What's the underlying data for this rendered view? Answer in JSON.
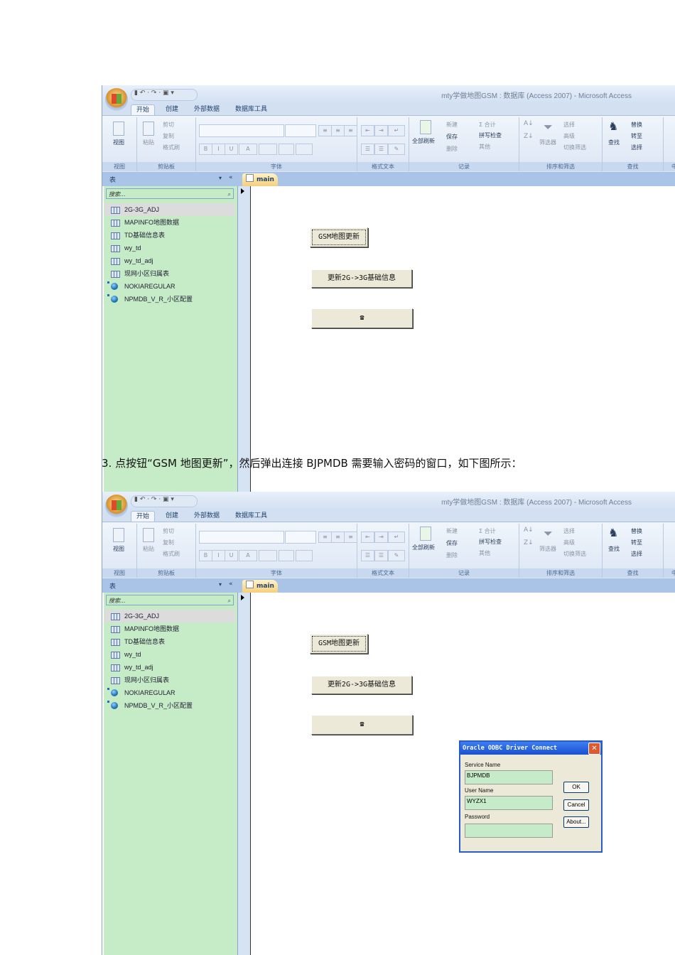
{
  "app": {
    "title": "mty学做地图GSM : 数据库 (Access 2007) - Microsoft Access",
    "qat": "▮ ↶ · ↷ · ▣ ▾",
    "tabs": [
      "开始",
      "创建",
      "外部数据",
      "数据库工具"
    ],
    "groups": {
      "view": {
        "label": "视图",
        "button": "视图"
      },
      "clipboard": {
        "label": "剪贴板",
        "paste": "粘贴",
        "cut": "剪切",
        "copy": "复制",
        "format_painter": "格式刷"
      },
      "font": {
        "label": "字体",
        "bold": "B",
        "italic": "I",
        "underline": "U",
        "color": "A"
      },
      "rich_text": {
        "label": "格式文本"
      },
      "records": {
        "label": "记录",
        "refresh_all": "全部刷新",
        "new": "新建",
        "save": "保存",
        "delete": "删除",
        "totals": "Σ 合计",
        "spelling": "拼写检查",
        "more": "其他"
      },
      "sort_filter": {
        "label": "排序和筛选",
        "filter": "筛选器",
        "selection": "选择",
        "advanced": "高级",
        "toggle_filter": "切换筛选"
      },
      "find": {
        "label": "查找",
        "find": "查找",
        "replace": "替换",
        "goto": "转至",
        "select": "选择"
      },
      "chinese": {
        "label": "中"
      }
    },
    "nav": {
      "header": "表",
      "search_placeholder": "搜索...",
      "items": [
        {
          "label": "2G-3G_ADJ",
          "type": "table"
        },
        {
          "label": "MAPINFO地图数据",
          "type": "table"
        },
        {
          "label": "TD基础信息表",
          "type": "table"
        },
        {
          "label": "wy_td",
          "type": "table"
        },
        {
          "label": "wy_td_adj",
          "type": "table"
        },
        {
          "label": "现网小区归属表",
          "type": "table"
        },
        {
          "label": "NOKIAREGULAR",
          "type": "linked"
        },
        {
          "label": "NPMDB_V_R_小区配置",
          "type": "linked"
        }
      ]
    },
    "doc_tab": "main",
    "form": {
      "btn_gsm": "GSM地图更新",
      "btn_update": "更新2G->3G基础信息",
      "btn_third": "☎"
    }
  },
  "paragraph": "3.  点按钮“GSM 地图更新”，然后弹出连接 BJPMDB 需要输入密码的窗口，如下图所示：",
  "dialog": {
    "title": "Oracle ODBC Driver Connect",
    "service_name_label": "Service Name",
    "service_name_value": "BJPMDB",
    "user_name_label": "User Name",
    "user_name_value": "WYZX1",
    "password_label": "Password",
    "password_value": "",
    "ok": "OK",
    "cancel": "Cancel",
    "about": "About..."
  }
}
